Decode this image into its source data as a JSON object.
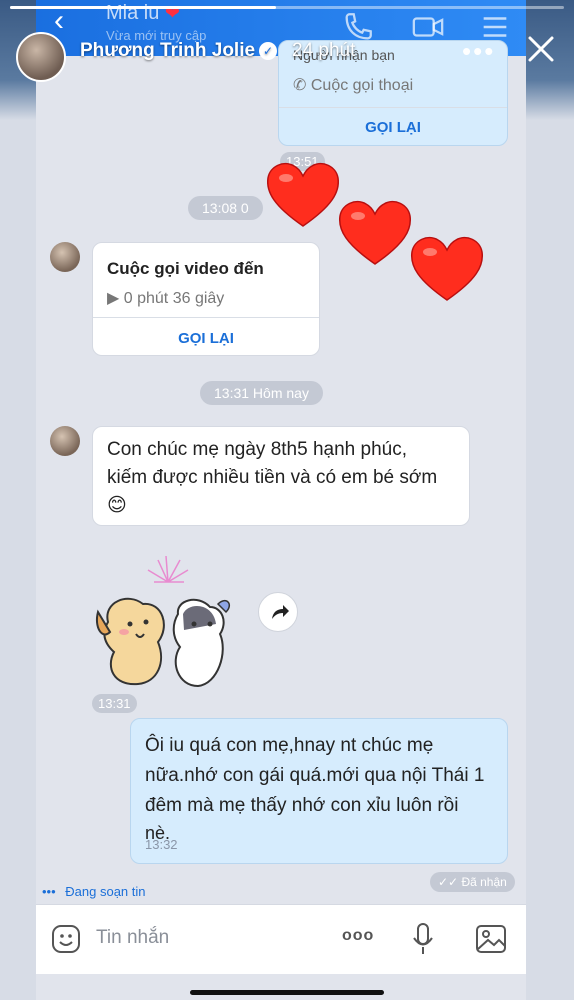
{
  "story": {
    "progress": 0.48,
    "name": "Phương Trinh Jolie",
    "time": "24 phút",
    "more_label": "•••"
  },
  "chat_header": {
    "contact": "Mia iu",
    "status": "Vừa mới truy cập"
  },
  "messages": {
    "outgoing_call": {
      "title": "Người nhận bạn",
      "type": "Cuộc gọi thoại",
      "action": "GỌI LẠI",
      "time": "13:51"
    },
    "date_pill_1": "13:08 0",
    "incoming_video": {
      "title": "Cuộc gọi video đến",
      "duration": "0 phút 36 giây",
      "action": "GỌI LẠI"
    },
    "date_pill_2": "13:31 Hôm nay",
    "received_text": {
      "line1": "Con chúc mẹ ngày 8th5 hạnh phúc,",
      "line2": "kiếm được nhiều tiền và có em bé sớm",
      "emoji": "😊"
    },
    "sticker_time": "13:31",
    "sent_text": {
      "line1": "Ôi iu quá con mẹ,hnay nt chúc mẹ",
      "line2": "nữa.nhớ con gái quá.mới qua nội Thái 1",
      "line3": "đêm mà mẹ thấy nhớ con xỉu luôn rồi",
      "line4": "nè.",
      "time": "13:32"
    },
    "status_received": "Đã nhận",
    "typing": "Đang soạn tin"
  },
  "composer": {
    "placeholder": "Tin nhắn",
    "more": "ooo"
  },
  "colors": {
    "accent": "#1b6fd8",
    "heart": "#ff3b30",
    "sent_bubble": "#d6ecfd"
  }
}
